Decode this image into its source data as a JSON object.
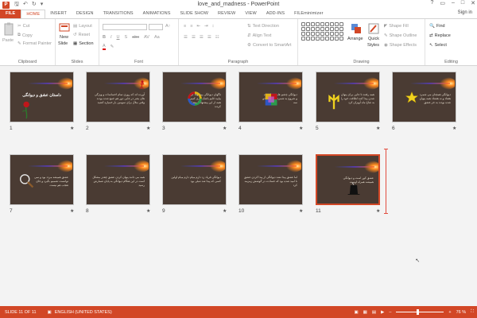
{
  "window": {
    "title": "love_and_madness - PowerPoint",
    "app_icon_letter": "P",
    "controls": [
      "?",
      "▭",
      "–",
      "□",
      "✕"
    ],
    "sign_in": "Sign in"
  },
  "tabs": [
    "FILE",
    "HOME",
    "INSERT",
    "DESIGN",
    "TRANSITIONS",
    "ANIMATIONS",
    "SLIDE SHOW",
    "REVIEW",
    "VIEW",
    "ADD-INS",
    "FILEminimizer"
  ],
  "active_tab": "HOME",
  "ribbon": {
    "clipboard": {
      "label": "Clipboard",
      "paste": "Paste",
      "cut": "Cut",
      "copy": "Copy",
      "format_painter": "Format Painter"
    },
    "slides": {
      "label": "Slides",
      "new_slide": "New",
      "new_slide2": "Slide",
      "layout": "Layout",
      "reset": "Reset",
      "section": "Section"
    },
    "font": {
      "label": "Font",
      "bold": "B",
      "italic": "I",
      "underline": "U",
      "shadow": "S",
      "strike": "abc",
      "char_spacing": "AV",
      "case": "Aa"
    },
    "paragraph": {
      "label": "Paragraph",
      "text_direction": "Text Direction",
      "align_text": "Align Text",
      "convert_smartart": "Convert to SmartArt"
    },
    "drawing": {
      "label": "Drawing",
      "arrange": "Arrange",
      "quick_styles": "Quick",
      "quick_styles2": "Styles",
      "shape_fill": "Shape Fill",
      "shape_outline": "Shape Outline",
      "shape_effects": "Shape Effects"
    },
    "editing": {
      "label": "Editing",
      "find": "Find",
      "replace": "Replace",
      "select": "Select"
    }
  },
  "slides": [
    {
      "num": "1",
      "title": "داستان عشق و دیوانگی",
      "body": "",
      "art": "rose"
    },
    {
      "num": "2",
      "title": "",
      "body": "آورده اند که روزی تمام احساسات و ویژگی های بشر در جایی دور هم جمع شده بودند وقتی ملال برای سومین بار خمیازه کشید",
      "art": "figure"
    },
    {
      "num": "3",
      "title": "",
      "body": "ناگهان دیوانگی پیشنهاد کرد بیایید قایم باشک بازی کنیم همه از این پیشنهاد استقبال کردند",
      "art": "wheel"
    },
    {
      "num": "4",
      "title": "",
      "body": "دیوانگی چشم هایش را بست و شروع به شمردن کرد یک دو سه",
      "art": "cube"
    },
    {
      "num": "5",
      "title": "",
      "body": "همه رفتند تا جایی برای پنهان شدن پیدا کنند لطافت خود را به شاخ ماه آویزان کرد",
      "art": "trident"
    },
    {
      "num": "6",
      "title": "",
      "body": "دیوانگی همچنان می شمرد هفتاد و نه هشتاد همه پنهان شده بودند به جز عشق",
      "art": "star"
    },
    {
      "num": "7",
      "title": "",
      "body": "عشق همیشه مردد بود و نمی توانست تصمیم بگیرد و جای تعجب هم نیست",
      "art": "magnifier"
    },
    {
      "num": "8",
      "title": "",
      "body": "همه می دانند پنهان کردن عشق چقدر مشکل است در این هنگام دیوانگی به پایان شمارش رسید",
      "art": "none"
    },
    {
      "num": "9",
      "title": "",
      "body": "دیوانگی فریاد زد دارم میام دارم میام اولین کسی که پیدا شد تنبلی بود",
      "art": "none"
    },
    {
      "num": "10",
      "title": "",
      "body": "اما عشق پیدا نشد دیوانگی از پیدا کردن عشق نا امید شده بود که حسادت در گوشش زمزمه کرد",
      "art": "none"
    },
    {
      "num": "11",
      "title": "",
      "body": "عشق کور است و دیوانگی همیشه همراه اوست",
      "art": "hat"
    }
  ],
  "status": {
    "slide_info": "SLIDE 11 OF 11",
    "language": "ENGLISH (UNITED STATES)",
    "zoom_minus": "–",
    "zoom_plus": "+",
    "zoom": "76 %",
    "zoom_fraction": 0.45
  },
  "colors": {
    "accent": "#d24726",
    "slide_bg": "#4a3b33"
  }
}
